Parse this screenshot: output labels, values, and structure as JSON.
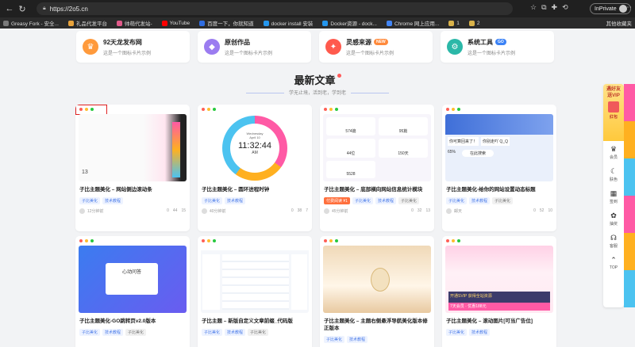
{
  "browser": {
    "url": "https://2o5.cn",
    "inprivate_label": "InPrivate",
    "bookmarks": [
      {
        "label": "Greasy Fork - 安全...",
        "color": "#7a7a7a"
      },
      {
        "label": "礼品代发平台",
        "color": "#e8a33c"
      },
      {
        "label": "帅萌代发站-",
        "color": "#e05a8a"
      },
      {
        "label": "YouTube",
        "color": "#ff0000"
      },
      {
        "label": "百度一下，你就知道",
        "color": "#2f6de1"
      },
      {
        "label": "docker install 安装",
        "color": "#2496ed"
      },
      {
        "label": "Docker资源 - dock...",
        "color": "#2496ed"
      },
      {
        "label": "Chrome 网上应用...",
        "color": "#4285f4"
      },
      {
        "label": "1",
        "color": "#d9b24a"
      },
      {
        "label": "2",
        "color": "#d9b24a"
      }
    ],
    "bookmarks_other": "其他收藏夹"
  },
  "features": [
    {
      "title": "92天龙发布网",
      "desc": "这是一个图标卡片示例",
      "icon": "crown-icon",
      "glyph": "♛",
      "color": "#ff9a3c",
      "badge": ""
    },
    {
      "title": "原创作品",
      "desc": "这是一个图标卡片示例",
      "icon": "diamond-icon",
      "glyph": "◆",
      "color": "#9b7cf0",
      "badge": ""
    },
    {
      "title": "灵感来源",
      "desc": "这是一个图标卡片示例",
      "icon": "flame-icon",
      "glyph": "✦",
      "color": "#ff5a4d",
      "badge": "NEW",
      "badge_color": "#ff8a3c"
    },
    {
      "title": "系统工具",
      "desc": "这是一个图标卡片示例",
      "icon": "tools-icon",
      "glyph": "⚙",
      "color": "#2bb8a8",
      "badge": "GO",
      "badge_color": "#3b82f6"
    }
  ],
  "section": {
    "title": "最新文章",
    "subtitle": "学无止境，活到老，学到老"
  },
  "cards": [
    {
      "title": "子比主题美化 – 网站侧边滚动条",
      "tags": [
        "子比美化",
        "技术教程"
      ],
      "author": "12分钟前",
      "stats": [
        "0",
        "44",
        "15"
      ]
    },
    {
      "title": "子比主题美化 – 圆环进程时钟",
      "tags": [
        "子比美化",
        "技术教程"
      ],
      "author": "40分钟前",
      "stats": [
        "0",
        "38",
        "7"
      ],
      "clock": {
        "day": "Wednesday",
        "date": "April 10",
        "time": "11:32:44",
        "ampm": "AM"
      }
    },
    {
      "title": "子比主题美化 – 底部横向网站信息统计模块",
      "tags": [
        "子比美化",
        "技术教程",
        "子比美化"
      ],
      "hot": "付费阅读 ¥1",
      "author": "45分钟前",
      "stats": [
        "0",
        "32",
        "13"
      ],
      "stats_boxes": [
        "574篇",
        "95篇",
        "44位",
        "150天",
        "5528"
      ]
    },
    {
      "title": "子比主题美化-给你的网站设置动态标题",
      "tags": [
        "子比美化",
        "技术教程",
        "子比美化"
      ],
      "author": "邮天",
      "stats": [
        "0",
        "52",
        "10"
      ],
      "tabs": [
        "你可算回来了！",
        "你别走吖 Q_Q"
      ],
      "search": "在此搜索",
      "pct": "65%"
    },
    {
      "title": "子比主题美化-GO跳转页v2.0版本",
      "tags": [
        "子比美化",
        "技术教程",
        "子比美化"
      ],
      "logo": "心动问答"
    },
    {
      "title": "子比主题 – 新版自定义文章前缀_代码版",
      "tags": [
        "子比美化",
        "技术教程",
        "子比美化"
      ]
    },
    {
      "title": "子比主题美化 – 主题右侧悬浮导航美化版本修正版本",
      "tags": [
        "子比美化",
        "技术教程"
      ]
    },
    {
      "title": "子比主题美化 – 滚动图片[可当广告位]",
      "tags": [
        "子比美化",
        "技术教程"
      ],
      "vip": "开通SVIP 获得全站资源",
      "price": "7天会员 · 优惠188元"
    }
  ],
  "sidebar": {
    "vip_label": "遇好友送VIP",
    "gift": "红包",
    "items": [
      {
        "label": "会员",
        "icon": "vip-icon",
        "glyph": "♛"
      },
      {
        "label": "肤色",
        "icon": "moon-icon",
        "glyph": "☾"
      },
      {
        "label": "签到",
        "icon": "calendar-icon",
        "glyph": "▦"
      },
      {
        "label": "抽奖",
        "icon": "gift-icon",
        "glyph": "✿"
      },
      {
        "label": "客服",
        "icon": "headset-icon",
        "glyph": "☊"
      },
      {
        "label": "TOP",
        "icon": "arrow-up-icon",
        "glyph": "⌃"
      }
    ]
  }
}
